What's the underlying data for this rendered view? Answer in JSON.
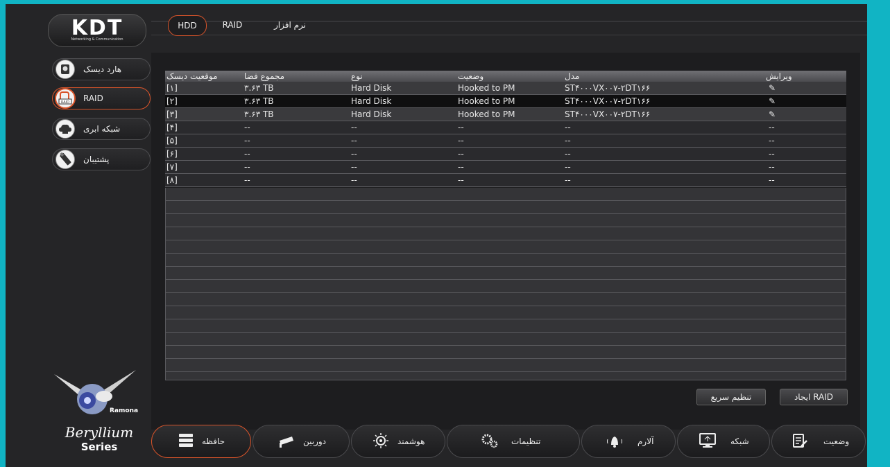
{
  "logo": {
    "mark": "KDT",
    "sub": "Networking & Communication"
  },
  "top_tabs": [
    "HDD",
    "RAID",
    "نرم افزار"
  ],
  "sidebar": [
    {
      "label": "هارد دیسک",
      "icon": "hard-disk-icon"
    },
    {
      "label": "RAID",
      "icon": "raid-icon"
    },
    {
      "label": "شبکه ابری",
      "icon": "cloud-icon"
    },
    {
      "label": "پشتیبان",
      "icon": "usb-backup-icon"
    }
  ],
  "table": {
    "headers": [
      "موقعیت دیسک",
      "مجموع فضا",
      "نوع",
      "وضعیت",
      "مدل",
      "ویرایش"
    ],
    "rows": [
      [
        "[۱]",
        "۳.۶۳ TB",
        "Hard Disk",
        "Hooked to PM",
        "ST۴۰۰۰VX۰۰۷-۲DT۱۶۶",
        "✎"
      ],
      [
        "[۲]",
        "۳.۶۳ TB",
        "Hard Disk",
        "Hooked to PM",
        "ST۴۰۰۰VX۰۰۷-۲DT۱۶۶",
        "✎"
      ],
      [
        "[۳]",
        "۳.۶۳ TB",
        "Hard Disk",
        "Hooked to PM",
        "ST۴۰۰۰VX۰۰۷-۲DT۱۶۶",
        "✎"
      ],
      [
        "[۴]",
        "--",
        "--",
        "--",
        "--",
        "--"
      ],
      [
        "[۵]",
        "--",
        "--",
        "--",
        "--",
        "--"
      ],
      [
        "[۶]",
        "--",
        "--",
        "--",
        "--",
        "--"
      ],
      [
        "[۷]",
        "--",
        "--",
        "--",
        "--",
        "--"
      ],
      [
        "[۸]",
        "--",
        "--",
        "--",
        "--",
        "--"
      ]
    ]
  },
  "buttons": {
    "quick_setup": "تنظیم سریع",
    "create_raid": "ایجاد RAID"
  },
  "bottom_nav": [
    {
      "label": "حافظه",
      "icon": "storage-icon"
    },
    {
      "label": "دوربین",
      "icon": "camera-icon"
    },
    {
      "label": "هوشمند",
      "icon": "smart-icon"
    },
    {
      "label": "تنظیمات",
      "icon": "gears-icon"
    },
    {
      "label": "آلارم",
      "icon": "alarm-bell-icon"
    },
    {
      "label": "شبکه",
      "icon": "network-icon"
    },
    {
      "label": "وضعیت",
      "icon": "status-icon"
    }
  ],
  "brand": {
    "mascot_name": "Ramona",
    "series_line1": "Beryllium",
    "series_line2": "Series"
  },
  "colors": {
    "accent": "#d9542a",
    "frame": "#11b4c4",
    "background": "#252527"
  }
}
